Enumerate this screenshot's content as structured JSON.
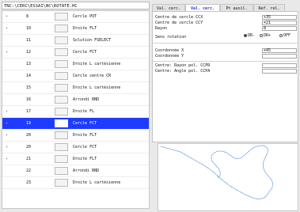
{
  "path_text": "TNC:\\CERC\\ESSAI\\NC\\ROTATE.HC",
  "rows": [
    {
      "mark": "›",
      "num": "8",
      "label": "Cercle POT"
    },
    {
      "mark": "›",
      "num": "10",
      "label": "Droite FLT"
    },
    {
      "mark": "",
      "num": "11",
      "label": "Solution FSELECT"
    },
    {
      "mark": "›",
      "num": "12",
      "label": "Cercle FCT"
    },
    {
      "mark": "",
      "num": "13",
      "label": "Droite L cartésienne"
    },
    {
      "mark": "",
      "num": "14",
      "label": "Cercle centre CR"
    },
    {
      "mark": "",
      "num": "15",
      "label": "Droite L cartésienne"
    },
    {
      "mark": "",
      "num": "16",
      "label": "Arrondi RND"
    },
    {
      "mark": "›",
      "num": "17",
      "label": "Droite FL"
    },
    {
      "mark": "›",
      "num": "19",
      "label": "Cercle FCT"
    },
    {
      "mark": "›",
      "num": "20",
      "label": "Droite FLT"
    },
    {
      "mark": "›",
      "num": "20",
      "label": "Cercle FCT"
    },
    {
      "mark": "›",
      "num": "21",
      "label": "Droite FLT"
    },
    {
      "mark": "",
      "num": "22",
      "label": "Arrondi RND"
    },
    {
      "mark": "",
      "num": "23",
      "label": "Droite L cartésienne"
    }
  ],
  "selected_index": 9,
  "tabs": [
    "Val. cerc.",
    "Val. cerc.",
    "Pt auxil.",
    "Ref. rel."
  ],
  "active_tab": 1,
  "fields": [
    {
      "label": "Centre de cercle CCX",
      "value": "+35"
    },
    {
      "label": "Centre de cercle CCY",
      "value": "+21"
    },
    {
      "label": "Rayon",
      "value": "8"
    }
  ],
  "rotation": {
    "label": "Sens rotation",
    "opt1": "DR-",
    "opt2": "DR+",
    "opt3": "OFF"
  },
  "coords": [
    {
      "label": "Coordonnée X",
      "value": "+45"
    },
    {
      "label": "Coordonnée Y",
      "value": ""
    }
  ],
  "polar": [
    {
      "label": "Centre: Rayon pol. CCPR",
      "value": ""
    },
    {
      "label": "Centre: Angle pol. CCPA",
      "value": ""
    }
  ]
}
